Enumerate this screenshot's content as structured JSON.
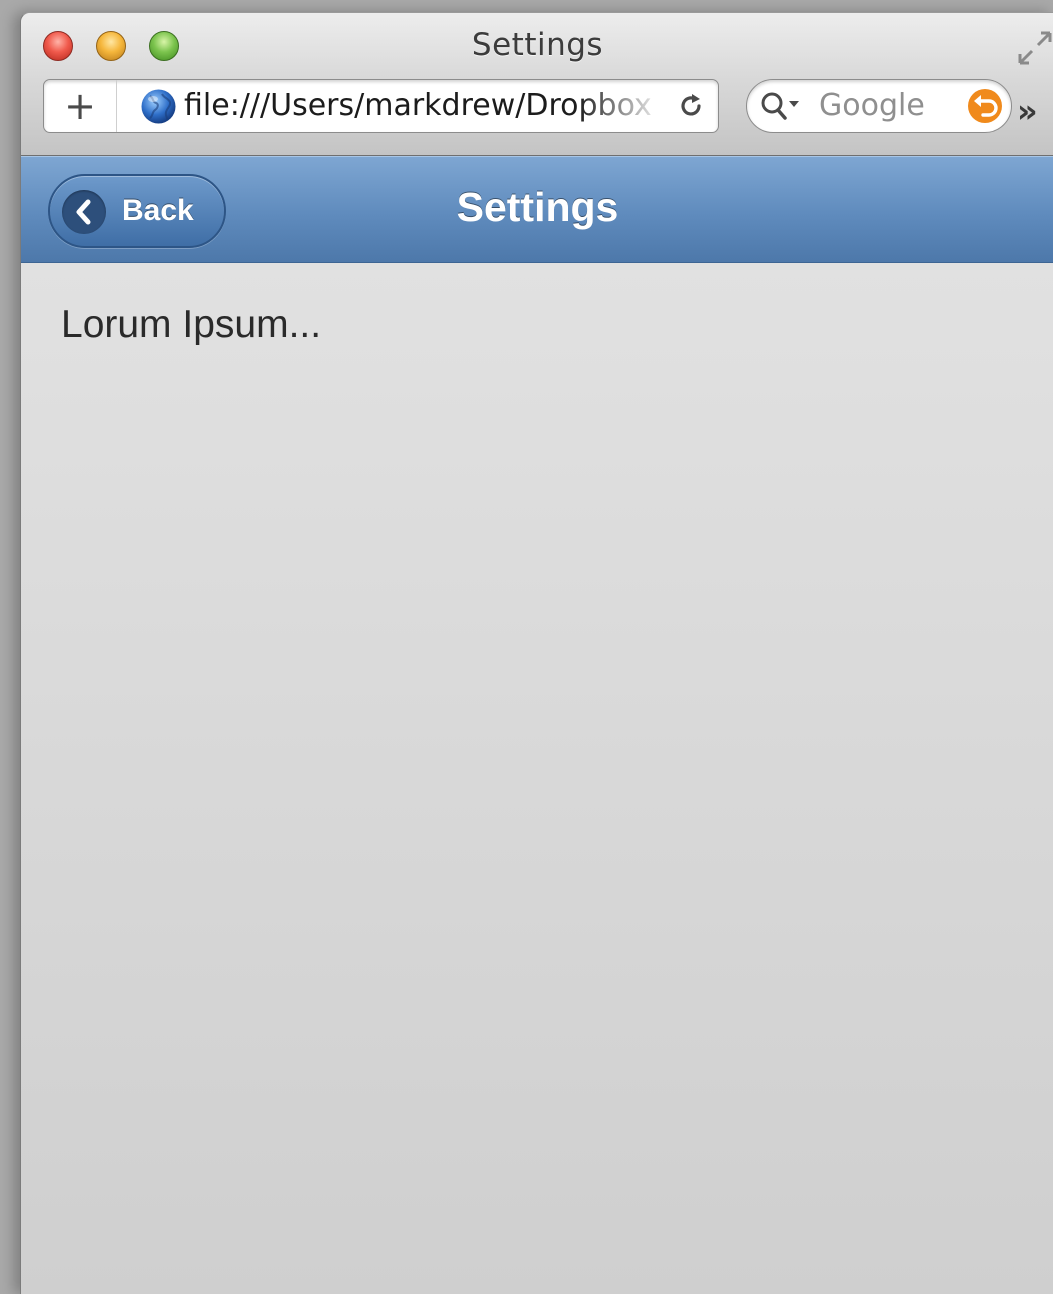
{
  "window": {
    "title": "Settings"
  },
  "toolbar": {
    "add_label": "+",
    "url": "file:///Users/markdrew/Dropbox",
    "search_placeholder": "Google",
    "overflow_label": "»"
  },
  "app_header": {
    "back_label": "Back",
    "title": "Settings"
  },
  "main": {
    "text": "Lorum Ipsum..."
  },
  "colors": {
    "header_blue": "#5f8bbd",
    "content_bg": "#d8d8d8",
    "snapback_orange": "#f08a1c"
  },
  "icons": [
    "close-button-icon",
    "minimize-button-icon",
    "zoom-button-icon",
    "fullscreen-icon",
    "globe-icon",
    "reload-icon",
    "search-icon",
    "snapback-icon",
    "chevron-left-icon"
  ]
}
